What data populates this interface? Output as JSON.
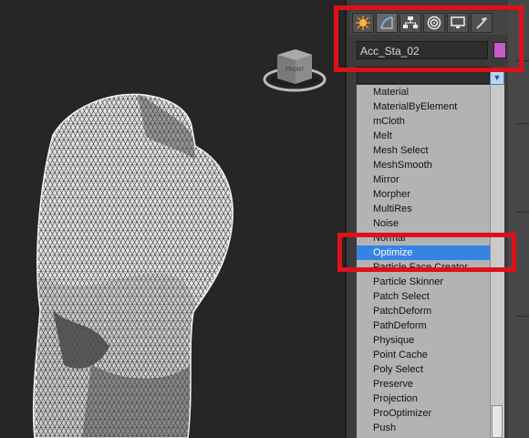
{
  "panel": {
    "object_name": "Acc_Sta_02",
    "object_color": "#c65bc6",
    "tabs": [
      "create-icon",
      "modify-icon",
      "hierarchy-icon",
      "motion-icon",
      "display-icon",
      "utilities-icon"
    ]
  },
  "viewcube": {
    "face_label": "FRONT"
  },
  "modifier_list": {
    "items": [
      "Material",
      "MaterialByElement",
      "mCloth",
      "Melt",
      "Mesh Select",
      "MeshSmooth",
      "Mirror",
      "Morpher",
      "MultiRes",
      "Noise",
      "Normal",
      "Optimize",
      "Particle Face Creator",
      "Particle Skinner",
      "Patch Select",
      "PatchDeform",
      "PathDeform",
      "Physique",
      "Point Cache",
      "Poly Select",
      "Preserve",
      "Projection",
      "ProOptimizer",
      "Push"
    ],
    "selected": "Optimize"
  },
  "colors": {
    "highlight": "#e0101a",
    "selection": "#3584e4",
    "list_background": "#b3b3b3"
  }
}
